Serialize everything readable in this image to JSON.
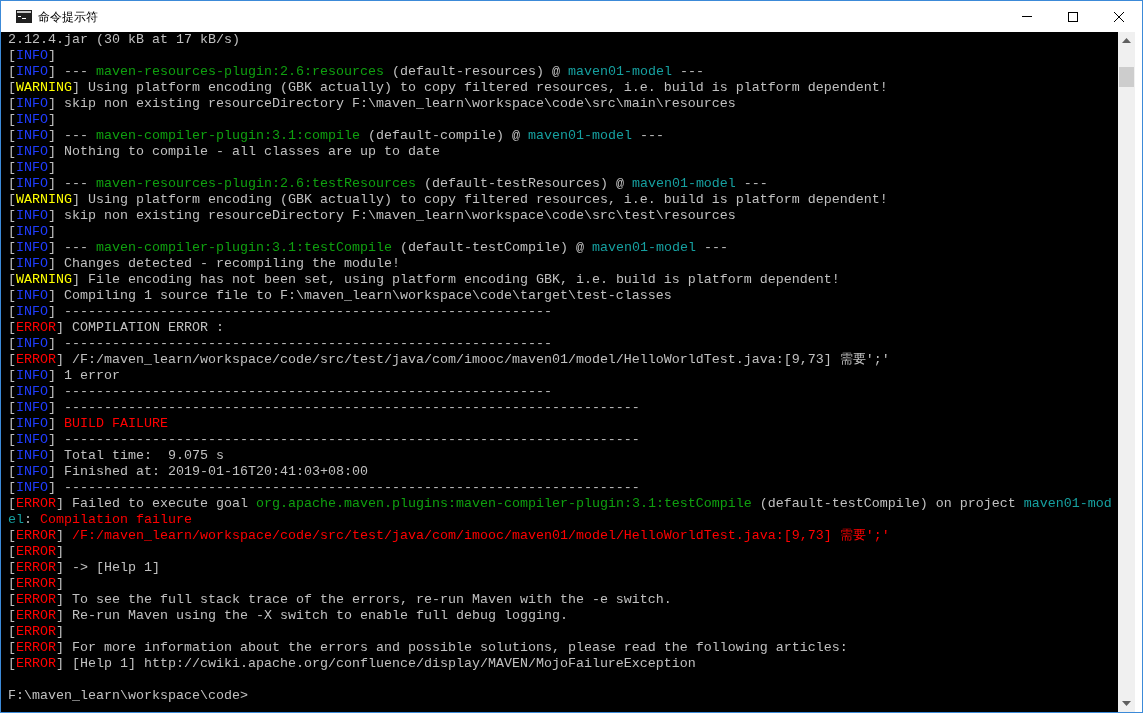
{
  "window": {
    "title": "命令提示符"
  },
  "console": {
    "lines": [
      [
        {
          "kind": "text",
          "text": "2.12.4.jar (30 kB at 17 kB/s)"
        }
      ],
      [
        {
          "kind": "text",
          "text": "["
        },
        {
          "kind": "info",
          "text": "INFO"
        },
        {
          "kind": "text",
          "text": "]"
        }
      ],
      [
        {
          "kind": "text",
          "text": "["
        },
        {
          "kind": "info",
          "text": "INFO"
        },
        {
          "kind": "text",
          "text": "] --- "
        },
        {
          "kind": "plugin",
          "text": "maven-resources-plugin:2.6:resources"
        },
        {
          "kind": "text",
          "text": " (default-resources) @ "
        },
        {
          "kind": "project",
          "text": "maven01-model"
        },
        {
          "kind": "text",
          "text": " ---"
        }
      ],
      [
        {
          "kind": "text",
          "text": "["
        },
        {
          "kind": "warning",
          "text": "WARNING"
        },
        {
          "kind": "text",
          "text": "] Using platform encoding (GBK actually) to copy filtered resources, i.e. build is platform dependent!"
        }
      ],
      [
        {
          "kind": "text",
          "text": "["
        },
        {
          "kind": "info",
          "text": "INFO"
        },
        {
          "kind": "text",
          "text": "] skip non existing resourceDirectory F:\\maven_learn\\workspace\\code\\src\\main\\resources"
        }
      ],
      [
        {
          "kind": "text",
          "text": "["
        },
        {
          "kind": "info",
          "text": "INFO"
        },
        {
          "kind": "text",
          "text": "]"
        }
      ],
      [
        {
          "kind": "text",
          "text": "["
        },
        {
          "kind": "info",
          "text": "INFO"
        },
        {
          "kind": "text",
          "text": "] --- "
        },
        {
          "kind": "plugin",
          "text": "maven-compiler-plugin:3.1:compile"
        },
        {
          "kind": "text",
          "text": " (default-compile) @ "
        },
        {
          "kind": "project",
          "text": "maven01-model"
        },
        {
          "kind": "text",
          "text": " ---"
        }
      ],
      [
        {
          "kind": "text",
          "text": "["
        },
        {
          "kind": "info",
          "text": "INFO"
        },
        {
          "kind": "text",
          "text": "] Nothing to compile - all classes are up to date"
        }
      ],
      [
        {
          "kind": "text",
          "text": "["
        },
        {
          "kind": "info",
          "text": "INFO"
        },
        {
          "kind": "text",
          "text": "]"
        }
      ],
      [
        {
          "kind": "text",
          "text": "["
        },
        {
          "kind": "info",
          "text": "INFO"
        },
        {
          "kind": "text",
          "text": "] --- "
        },
        {
          "kind": "plugin",
          "text": "maven-resources-plugin:2.6:testResources"
        },
        {
          "kind": "text",
          "text": " (default-testResources) @ "
        },
        {
          "kind": "project",
          "text": "maven01-model"
        },
        {
          "kind": "text",
          "text": " ---"
        }
      ],
      [
        {
          "kind": "text",
          "text": "["
        },
        {
          "kind": "warning",
          "text": "WARNING"
        },
        {
          "kind": "text",
          "text": "] Using platform encoding (GBK actually) to copy filtered resources, i.e. build is platform dependent!"
        }
      ],
      [
        {
          "kind": "text",
          "text": "["
        },
        {
          "kind": "info",
          "text": "INFO"
        },
        {
          "kind": "text",
          "text": "] skip non existing resourceDirectory F:\\maven_learn\\workspace\\code\\src\\test\\resources"
        }
      ],
      [
        {
          "kind": "text",
          "text": "["
        },
        {
          "kind": "info",
          "text": "INFO"
        },
        {
          "kind": "text",
          "text": "]"
        }
      ],
      [
        {
          "kind": "text",
          "text": "["
        },
        {
          "kind": "info",
          "text": "INFO"
        },
        {
          "kind": "text",
          "text": "] --- "
        },
        {
          "kind": "plugin",
          "text": "maven-compiler-plugin:3.1:testCompile"
        },
        {
          "kind": "text",
          "text": " (default-testCompile) @ "
        },
        {
          "kind": "project",
          "text": "maven01-model"
        },
        {
          "kind": "text",
          "text": " ---"
        }
      ],
      [
        {
          "kind": "text",
          "text": "["
        },
        {
          "kind": "info",
          "text": "INFO"
        },
        {
          "kind": "text",
          "text": "] Changes detected - recompiling the module!"
        }
      ],
      [
        {
          "kind": "text",
          "text": "["
        },
        {
          "kind": "warning",
          "text": "WARNING"
        },
        {
          "kind": "text",
          "text": "] File encoding has not been set, using platform encoding GBK, i.e. build is platform dependent!"
        }
      ],
      [
        {
          "kind": "text",
          "text": "["
        },
        {
          "kind": "info",
          "text": "INFO"
        },
        {
          "kind": "text",
          "text": "] Compiling 1 source file to F:\\maven_learn\\workspace\\code\\target\\test-classes"
        }
      ],
      [
        {
          "kind": "text",
          "text": "["
        },
        {
          "kind": "info",
          "text": "INFO"
        },
        {
          "kind": "text",
          "text": "] -------------------------------------------------------------"
        }
      ],
      [
        {
          "kind": "text",
          "text": "["
        },
        {
          "kind": "error",
          "text": "ERROR"
        },
        {
          "kind": "text",
          "text": "] COMPILATION ERROR :"
        }
      ],
      [
        {
          "kind": "text",
          "text": "["
        },
        {
          "kind": "info",
          "text": "INFO"
        },
        {
          "kind": "text",
          "text": "] -------------------------------------------------------------"
        }
      ],
      [
        {
          "kind": "text",
          "text": "["
        },
        {
          "kind": "error",
          "text": "ERROR"
        },
        {
          "kind": "text",
          "text": "] /F:/maven_learn/workspace/code/src/test/java/com/imooc/maven01/model/HelloWorldTest.java:[9,73] 需要';'"
        }
      ],
      [
        {
          "kind": "text",
          "text": "["
        },
        {
          "kind": "info",
          "text": "INFO"
        },
        {
          "kind": "text",
          "text": "] 1 error"
        }
      ],
      [
        {
          "kind": "text",
          "text": "["
        },
        {
          "kind": "info",
          "text": "INFO"
        },
        {
          "kind": "text",
          "text": "] -------------------------------------------------------------"
        }
      ],
      [
        {
          "kind": "text",
          "text": "["
        },
        {
          "kind": "info",
          "text": "INFO"
        },
        {
          "kind": "text",
          "text": "] ------------------------------------------------------------------------"
        }
      ],
      [
        {
          "kind": "text",
          "text": "["
        },
        {
          "kind": "info",
          "text": "INFO"
        },
        {
          "kind": "text",
          "text": "] "
        },
        {
          "kind": "failure",
          "text": "BUILD FAILURE"
        }
      ],
      [
        {
          "kind": "text",
          "text": "["
        },
        {
          "kind": "info",
          "text": "INFO"
        },
        {
          "kind": "text",
          "text": "] ------------------------------------------------------------------------"
        }
      ],
      [
        {
          "kind": "text",
          "text": "["
        },
        {
          "kind": "info",
          "text": "INFO"
        },
        {
          "kind": "text",
          "text": "] Total time:  9.075 s"
        }
      ],
      [
        {
          "kind": "text",
          "text": "["
        },
        {
          "kind": "info",
          "text": "INFO"
        },
        {
          "kind": "text",
          "text": "] Finished at: 2019-01-16T20:41:03+08:00"
        }
      ],
      [
        {
          "kind": "text",
          "text": "["
        },
        {
          "kind": "info",
          "text": "INFO"
        },
        {
          "kind": "text",
          "text": "] ------------------------------------------------------------------------"
        }
      ],
      [
        {
          "kind": "text",
          "text": "["
        },
        {
          "kind": "error",
          "text": "ERROR"
        },
        {
          "kind": "text",
          "text": "] Failed to execute goal "
        },
        {
          "kind": "plugin",
          "text": "org.apache.maven.plugins:maven-compiler-plugin:3.1:testCompile"
        },
        {
          "kind": "text",
          "text": " (default-testCompile) on project "
        },
        {
          "kind": "project",
          "text": "maven01-mod"
        }
      ],
      [
        {
          "kind": "project",
          "text": "el"
        },
        {
          "kind": "text",
          "text": ": "
        },
        {
          "kind": "failure",
          "text": "Compilation failure"
        }
      ],
      [
        {
          "kind": "text",
          "text": "["
        },
        {
          "kind": "error",
          "text": "ERROR"
        },
        {
          "kind": "text",
          "text": "] "
        },
        {
          "kind": "failure",
          "text": "/F:/maven_learn/workspace/code/src/test/java/com/imooc/maven01/model/HelloWorldTest.java:[9,73] 需要';'"
        }
      ],
      [
        {
          "kind": "text",
          "text": "["
        },
        {
          "kind": "error",
          "text": "ERROR"
        },
        {
          "kind": "text",
          "text": "]"
        }
      ],
      [
        {
          "kind": "text",
          "text": "["
        },
        {
          "kind": "error",
          "text": "ERROR"
        },
        {
          "kind": "text",
          "text": "] -> [Help 1]"
        }
      ],
      [
        {
          "kind": "text",
          "text": "["
        },
        {
          "kind": "error",
          "text": "ERROR"
        },
        {
          "kind": "text",
          "text": "]"
        }
      ],
      [
        {
          "kind": "text",
          "text": "["
        },
        {
          "kind": "error",
          "text": "ERROR"
        },
        {
          "kind": "text",
          "text": "] To see the full stack trace of the errors, re-run Maven with the -e switch."
        }
      ],
      [
        {
          "kind": "text",
          "text": "["
        },
        {
          "kind": "error",
          "text": "ERROR"
        },
        {
          "kind": "text",
          "text": "] Re-run Maven using the -X switch to enable full debug logging."
        }
      ],
      [
        {
          "kind": "text",
          "text": "["
        },
        {
          "kind": "error",
          "text": "ERROR"
        },
        {
          "kind": "text",
          "text": "]"
        }
      ],
      [
        {
          "kind": "text",
          "text": "["
        },
        {
          "kind": "error",
          "text": "ERROR"
        },
        {
          "kind": "text",
          "text": "] For more information about the errors and possible solutions, please read the following articles:"
        }
      ],
      [
        {
          "kind": "text",
          "text": "["
        },
        {
          "kind": "error",
          "text": "ERROR"
        },
        {
          "kind": "text",
          "text": "] [Help 1] http://cwiki.apache.org/confluence/display/MAVEN/MojoFailureException"
        }
      ]
    ],
    "prompt": "F:\\maven_learn\\workspace\\code>"
  }
}
